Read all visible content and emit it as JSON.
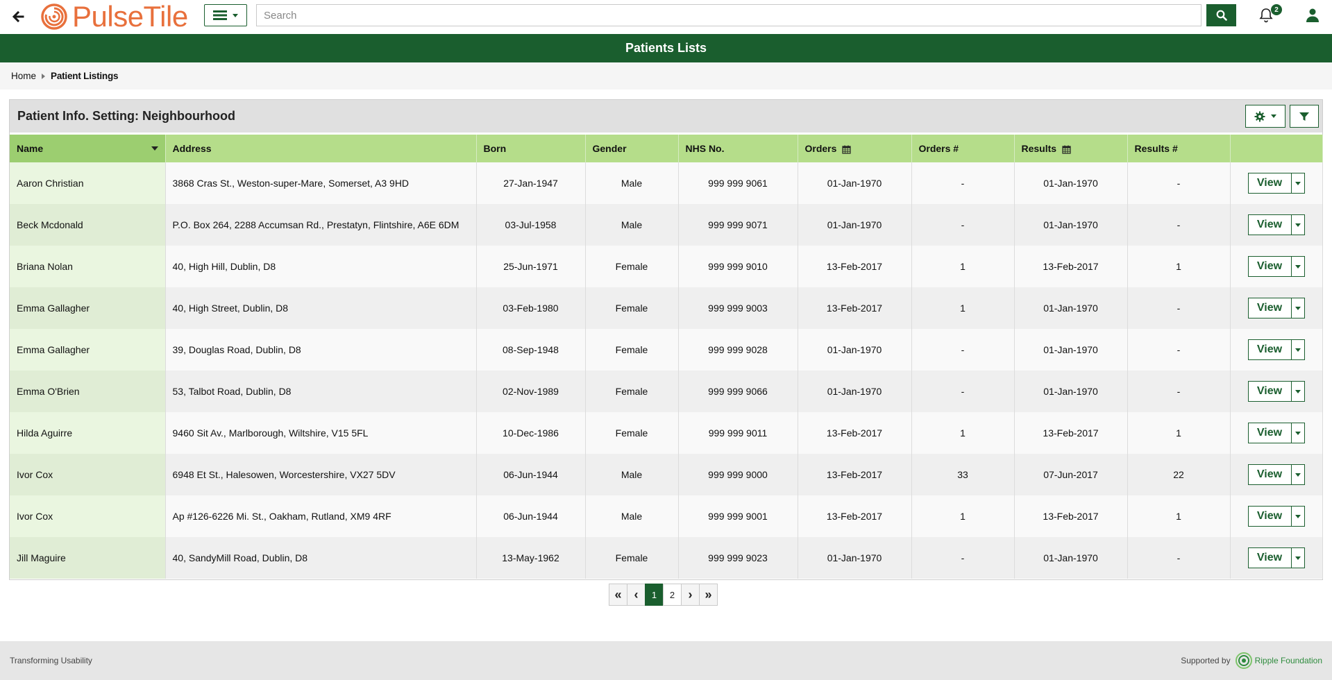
{
  "app": {
    "logo_text": "PulseTile",
    "search_placeholder": "Search",
    "notification_count": "2"
  },
  "header": {
    "title": "Patients Lists"
  },
  "breadcrumb": {
    "home": "Home",
    "current": "Patient Listings"
  },
  "panel": {
    "title": "Patient Info. Setting: Neighbourhood"
  },
  "table": {
    "columns": [
      "Name",
      "Address",
      "Born",
      "Gender",
      "NHS No.",
      "Orders",
      "Orders #",
      "Results",
      "Results #",
      ""
    ],
    "view_label": "View",
    "rows": [
      {
        "name": "Aaron Christian",
        "address": "3868 Cras St., Weston-super-Mare, Somerset, A3 9HD",
        "born": "27-Jan-1947",
        "gender": "Male",
        "nhs": "999 999 9061",
        "orders": "01-Jan-1970",
        "orders_n": "-",
        "results": "01-Jan-1970",
        "results_n": "-"
      },
      {
        "name": "Beck Mcdonald",
        "address": "P.O. Box 264, 2288 Accumsan Rd., Prestatyn, Flintshire, A6E 6DM",
        "born": "03-Jul-1958",
        "gender": "Male",
        "nhs": "999 999 9071",
        "orders": "01-Jan-1970",
        "orders_n": "-",
        "results": "01-Jan-1970",
        "results_n": "-"
      },
      {
        "name": "Briana Nolan",
        "address": "40, High Hill, Dublin, D8",
        "born": "25-Jun-1971",
        "gender": "Female",
        "nhs": "999 999 9010",
        "orders": "13-Feb-2017",
        "orders_n": "1",
        "results": "13-Feb-2017",
        "results_n": "1"
      },
      {
        "name": "Emma Gallagher",
        "address": "40, High Street, Dublin, D8",
        "born": "03-Feb-1980",
        "gender": "Female",
        "nhs": "999 999 9003",
        "orders": "13-Feb-2017",
        "orders_n": "1",
        "results": "01-Jan-1970",
        "results_n": "-"
      },
      {
        "name": "Emma Gallagher",
        "address": "39, Douglas Road, Dublin, D8",
        "born": "08-Sep-1948",
        "gender": "Female",
        "nhs": "999 999 9028",
        "orders": "01-Jan-1970",
        "orders_n": "-",
        "results": "01-Jan-1970",
        "results_n": "-"
      },
      {
        "name": "Emma O'Brien",
        "address": "53, Talbot Road, Dublin, D8",
        "born": "02-Nov-1989",
        "gender": "Female",
        "nhs": "999 999 9066",
        "orders": "01-Jan-1970",
        "orders_n": "-",
        "results": "01-Jan-1970",
        "results_n": "-"
      },
      {
        "name": "Hilda Aguirre",
        "address": "9460 Sit Av., Marlborough, Wiltshire, V15 5FL",
        "born": "10-Dec-1986",
        "gender": "Female",
        "nhs": "999 999 9011",
        "orders": "13-Feb-2017",
        "orders_n": "1",
        "results": "13-Feb-2017",
        "results_n": "1"
      },
      {
        "name": "Ivor Cox",
        "address": "6948 Et St., Halesowen, Worcestershire, VX27 5DV",
        "born": "06-Jun-1944",
        "gender": "Male",
        "nhs": "999 999 9000",
        "orders": "13-Feb-2017",
        "orders_n": "33",
        "results": "07-Jun-2017",
        "results_n": "22"
      },
      {
        "name": "Ivor Cox",
        "address": "Ap #126-6226 Mi. St., Oakham, Rutland, XM9 4RF",
        "born": "06-Jun-1944",
        "gender": "Male",
        "nhs": "999 999 9001",
        "orders": "13-Feb-2017",
        "orders_n": "1",
        "results": "13-Feb-2017",
        "results_n": "1"
      },
      {
        "name": "Jill Maguire",
        "address": "40, SandyMill Road, Dublin, D8",
        "born": "13-May-1962",
        "gender": "Female",
        "nhs": "999 999 9023",
        "orders": "01-Jan-1970",
        "orders_n": "-",
        "results": "01-Jan-1970",
        "results_n": "-"
      }
    ]
  },
  "pagination": {
    "first": "«",
    "prev": "‹",
    "pages": [
      "1",
      "2"
    ],
    "active": "1",
    "next": "›",
    "last": "»"
  },
  "footer": {
    "left": "Transforming Usability",
    "supported_by": "Supported by",
    "sponsor": "Ripple Foundation"
  },
  "colors": {
    "brand_green": "#1a5e2e",
    "header_green": "#b5dd8a",
    "logo_orange": "#e8703c"
  }
}
